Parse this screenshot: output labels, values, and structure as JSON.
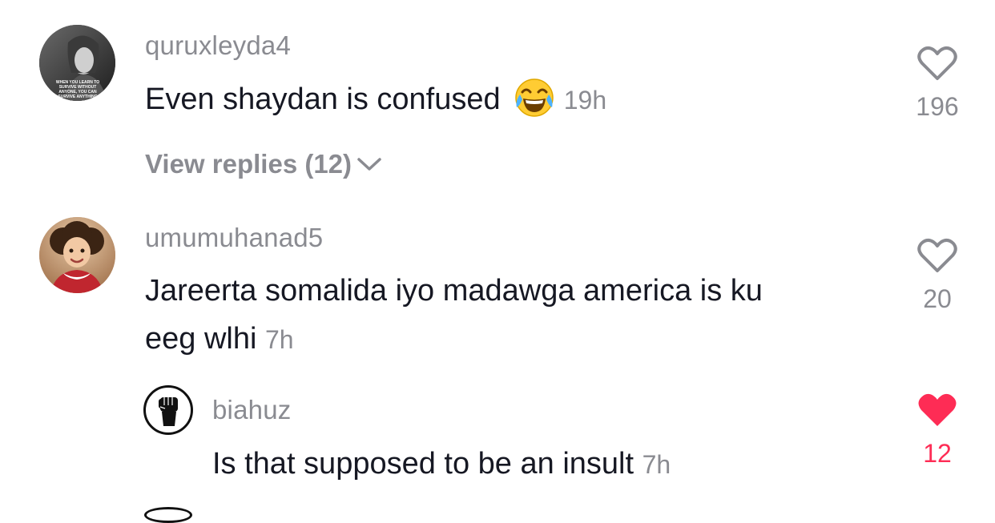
{
  "comments": [
    {
      "username": "quruxleyda4",
      "text": "Even shaydan is confused",
      "emoji": "face-with-tears-of-joy",
      "time": "19h",
      "likes": "196",
      "liked": false,
      "avatar_caption": "WHEN YOU LEARN TO SURVIVE WITHOUT ANYONE, YOU CAN SURVIVE ANYTHING",
      "view_replies": "View replies (12)"
    },
    {
      "username": "umumuhanad5",
      "text_line1": "Jareerta somalida iyo madawga america is ku",
      "text_line2": "eeg wlhi",
      "time": "7h",
      "likes": "20",
      "liked": false
    }
  ],
  "reply": {
    "username": "biahuz",
    "text": "Is that supposed to be an insult",
    "time": "7h",
    "likes": "12",
    "liked": true
  },
  "colors": {
    "username": "#8a8b91",
    "text": "#161823",
    "like_active": "#fe2c55"
  }
}
